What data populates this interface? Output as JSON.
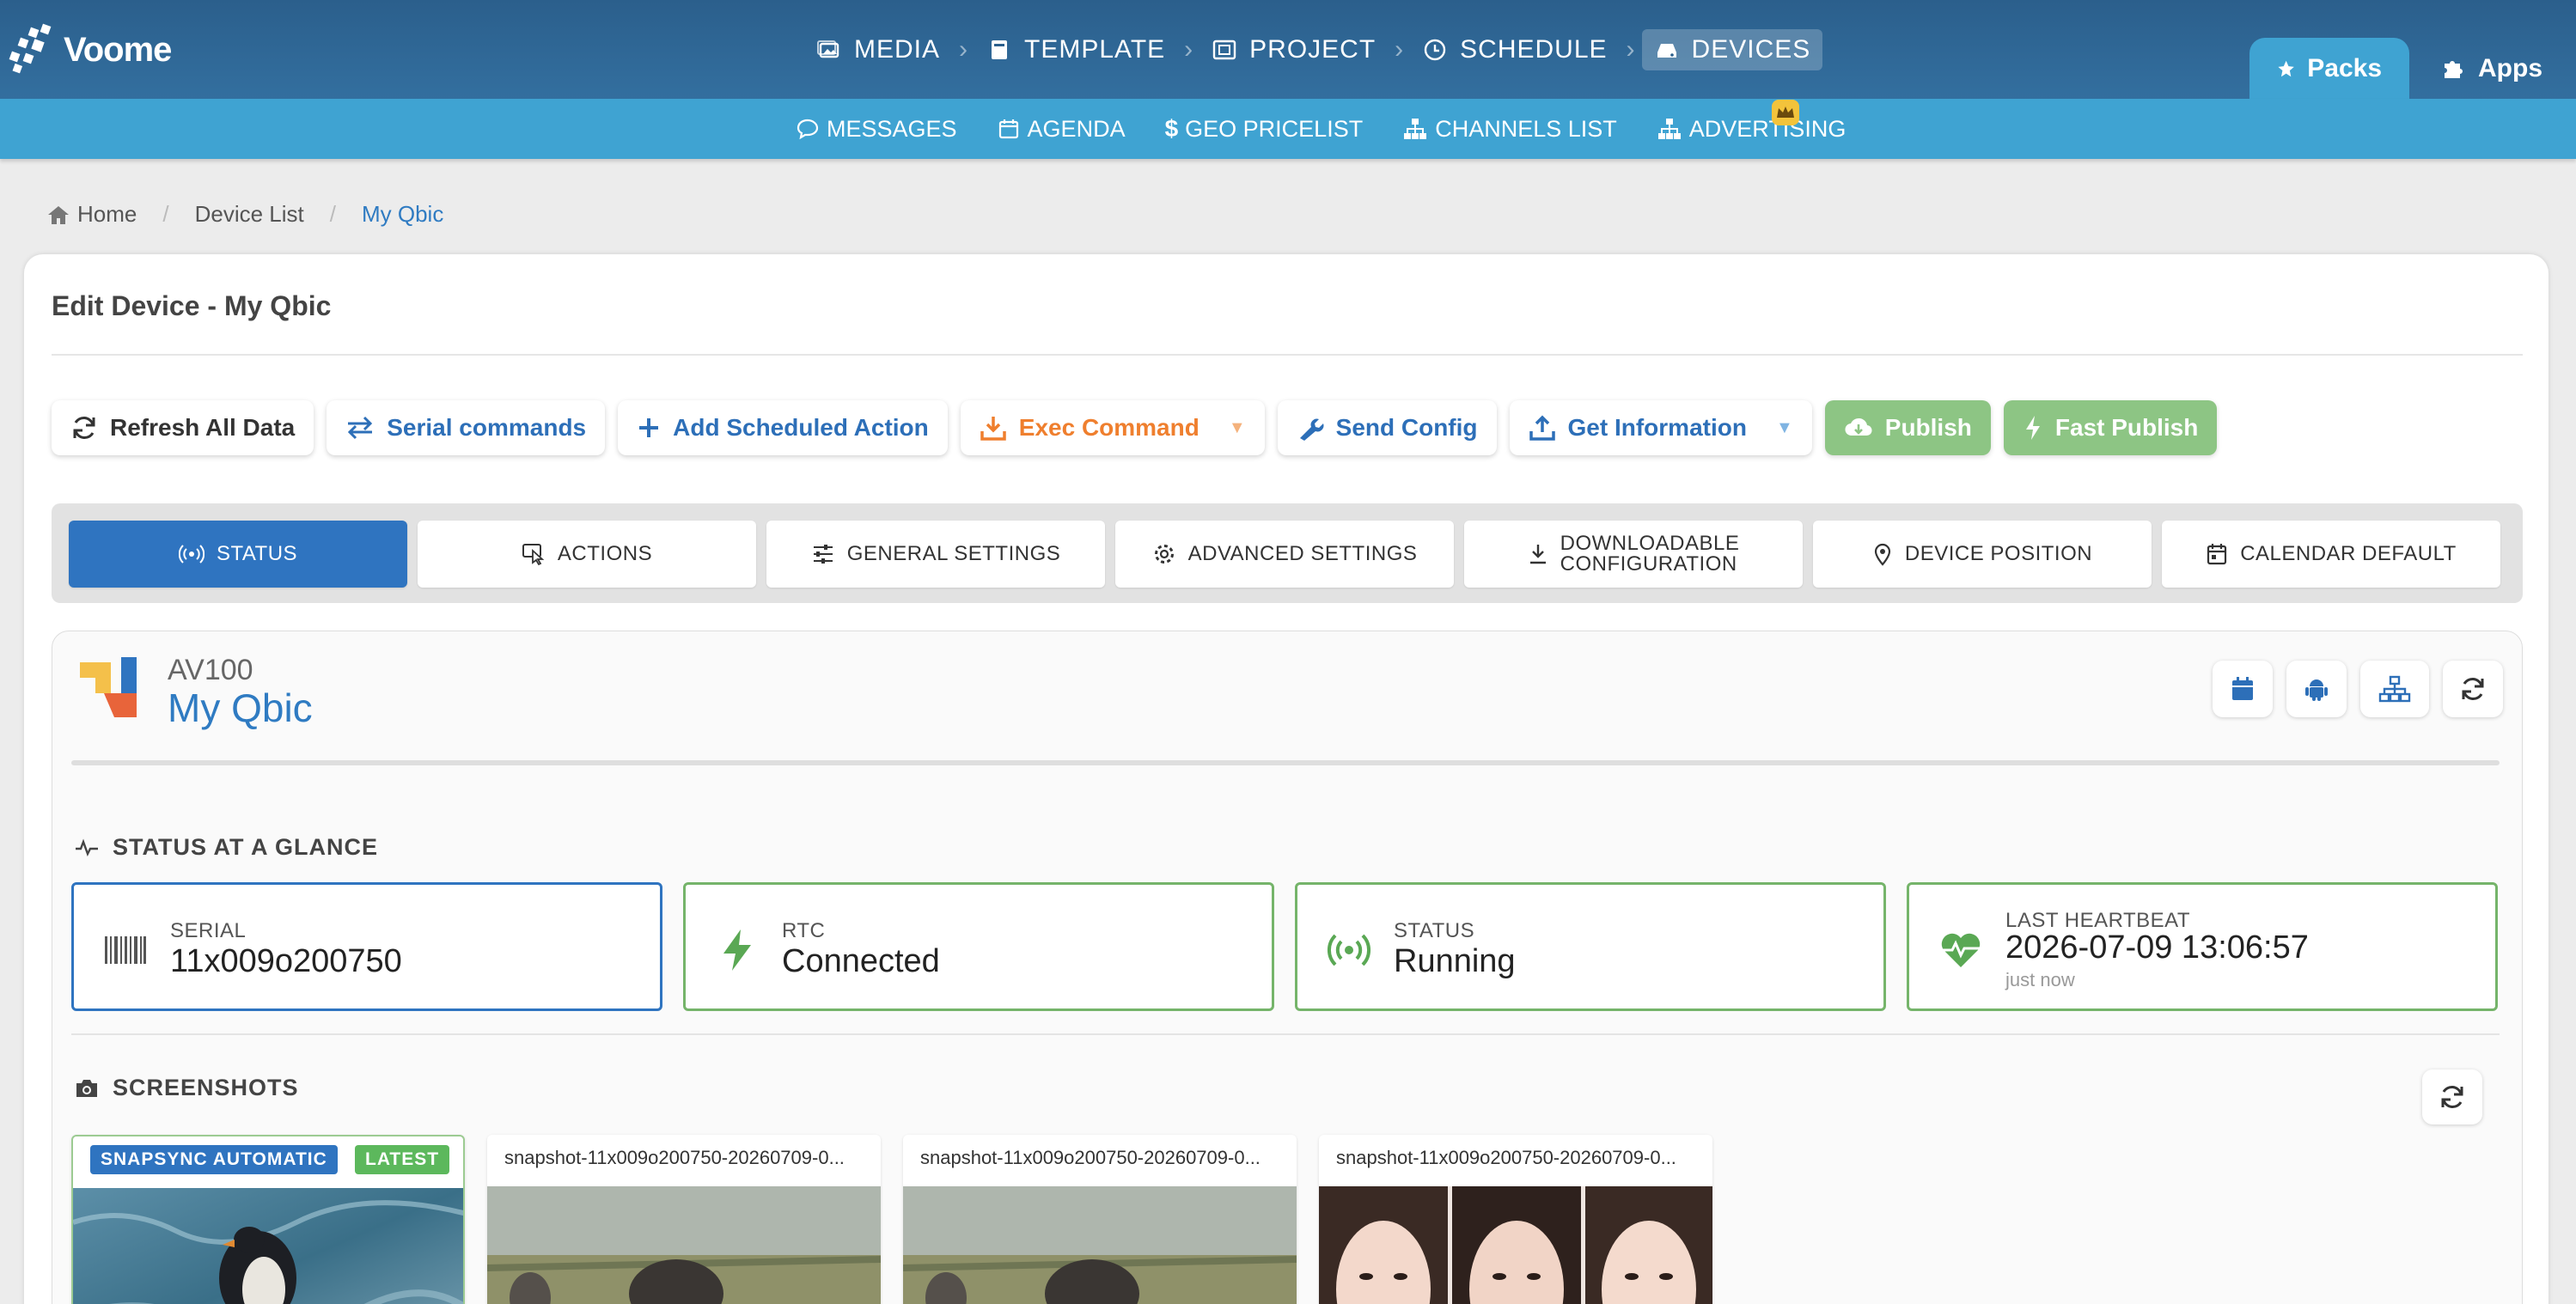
{
  "app": {
    "brand": "Voome"
  },
  "main_nav": [
    {
      "label": "MEDIA",
      "icon": "images-icon"
    },
    {
      "label": "TEMPLATE",
      "icon": "book-icon"
    },
    {
      "label": "PROJECT",
      "icon": "project-icon"
    },
    {
      "label": "SCHEDULE",
      "icon": "clock-icon"
    },
    {
      "label": "DEVICES",
      "icon": "hdd-icon",
      "active": true
    }
  ],
  "top_tabs": {
    "packs": "Packs",
    "apps": "Apps"
  },
  "sub_nav": [
    {
      "label": "MESSAGES",
      "icon": "comment-icon"
    },
    {
      "label": "AGENDA",
      "icon": "calendar-icon"
    },
    {
      "label": "GEO PRICELIST",
      "icon": "dollar-icon"
    },
    {
      "label": "CHANNELS LIST",
      "icon": "sitemap-icon"
    },
    {
      "label": "ADVERTISING",
      "icon": "sitemap-icon",
      "premium": true
    }
  ],
  "breadcrumb": {
    "home": "Home",
    "list": "Device List",
    "current": "My Qbic"
  },
  "panel": {
    "title": "Edit Device - My Qbic"
  },
  "actions": {
    "refresh": "Refresh All Data",
    "serial": "Serial commands",
    "add_scheduled": "Add Scheduled Action",
    "exec": "Exec Command",
    "send_config": "Send Config",
    "get_info": "Get Information",
    "publish": "Publish",
    "fast_publish": "Fast Publish"
  },
  "tabs": [
    {
      "label": "STATUS",
      "icon": "broadcast-icon",
      "active": true
    },
    {
      "label": "ACTIONS",
      "icon": "hand-pointer-icon"
    },
    {
      "label": "GENERAL SETTINGS",
      "icon": "sliders-icon"
    },
    {
      "label": "ADVANCED SETTINGS",
      "icon": "gear-icon"
    },
    {
      "label": "DOWNLOADABLE",
      "label2": "CONFIGURATION",
      "icon": "download-icon"
    },
    {
      "label": "DEVICE POSITION",
      "icon": "map-pin-icon"
    },
    {
      "label": "CALENDAR DEFAULT",
      "icon": "calendar-icon"
    }
  ],
  "device": {
    "model": "AV100",
    "name": "My Qbic"
  },
  "status_section": {
    "title": "STATUS AT A GLANCE"
  },
  "stats": {
    "serial": {
      "label": "SERIAL",
      "value": "11x009o200750"
    },
    "rtc": {
      "label": "RTC",
      "value": "Connected"
    },
    "status": {
      "label": "STATUS",
      "value": "Running"
    },
    "heartbeat": {
      "label": "LAST HEARTBEAT",
      "value": "2026-07-09 13:06:57",
      "sub": "just now"
    }
  },
  "screenshots_section": {
    "title": "SCREENSHOTS"
  },
  "screenshots": {
    "first": {
      "badge": "SNAPSYNC AUTOMATIC",
      "badge2": "LATEST"
    },
    "items": [
      "snapshot-11x009o200750-20260709-0...",
      "snapshot-11x009o200750-20260709-0...",
      "snapshot-11x009o200750-20260709-0..."
    ]
  },
  "colors": {
    "nav": "#2b5f8c",
    "subnav": "#3fa3d2",
    "primary": "#2f74c0",
    "success": "#75b46a",
    "orange": "#ef7f2e"
  }
}
